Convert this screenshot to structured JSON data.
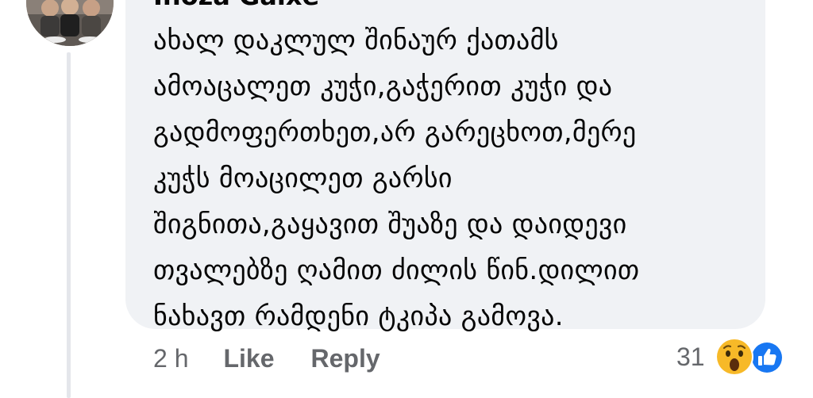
{
  "comment": {
    "author": "Inoza Gaixe",
    "text_lines": [
      "ახალ დაკლულ შინაურ ქათამს",
      "ამოაცალეთ კუჭი,გაჭერით კუჭი და",
      "გადმოფერთხეთ,არ გარეცხოთ,მერე",
      "კუჭს მოაცილეთ გარსი",
      "შიგნითა,გაყავით შუაზე და დაიდევი",
      "თვალებზე ღამით ძილის წინ.დილით",
      "ნახავთ რამდენი ტკიპა გამოვა."
    ],
    "timestamp": "2 h",
    "like_label": "Like",
    "reply_label": "Reply",
    "reaction_count": "31",
    "reaction_icons": [
      "wow-emoji",
      "like-thumb"
    ]
  },
  "colors": {
    "bubble_background": "#f0f2f5",
    "text": "#050505",
    "secondary_text": "#65676b",
    "like_blue": "#1877f2",
    "wow_yellow": "#f7b928"
  }
}
